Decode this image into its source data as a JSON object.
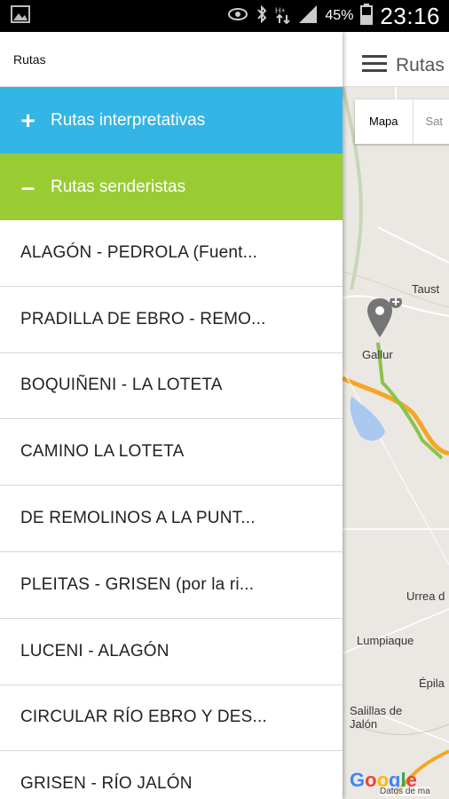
{
  "status_bar": {
    "battery_percent": "45%",
    "time": "23:16",
    "icons": [
      "gallery-icon",
      "eye-icon",
      "bluetooth-icon",
      "data-arrows-icon",
      "signal-icon",
      "battery-icon"
    ]
  },
  "app_bar": {
    "title": "Rutas",
    "menu_icon": "hamburger-menu-icon"
  },
  "map": {
    "type_buttons": [
      "Mapa",
      "Sat"
    ],
    "places": [
      "Taust",
      "Gallur",
      "Urrea d",
      "Lumpiaque",
      "Épila",
      "Salillas de Jalón"
    ],
    "logo": "Google",
    "credit": "Datos de ma"
  },
  "drawer": {
    "header": "Rutas",
    "categories": [
      {
        "sign": "+",
        "label": "Rutas interpretativas",
        "color": "#33b5e5"
      },
      {
        "sign": "–",
        "label": "Rutas senderistas",
        "color": "#99cc33"
      }
    ],
    "routes": [
      "ALAGÓN - PEDROLA (Fuent...",
      "PRADILLA DE EBRO - REMO...",
      "BOQUIÑENI - LA LOTETA",
      "CAMINO LA LOTETA",
      "DE REMOLINOS A LA PUNT...",
      "PLEITAS - GRISEN (por la ri...",
      "LUCENI - ALAGÓN",
      "CIRCULAR RÍO EBRO Y DES...",
      "GRISEN - RÍO JALÓN"
    ]
  }
}
